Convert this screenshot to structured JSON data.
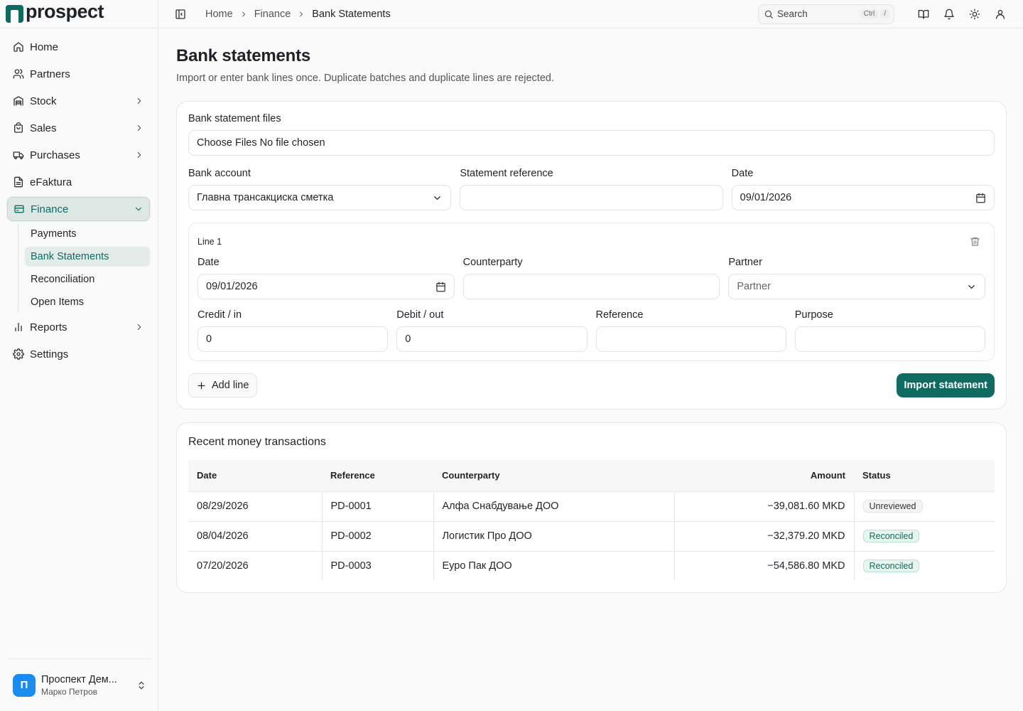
{
  "app": {
    "name": "prospect"
  },
  "sidebar": {
    "items": [
      {
        "label": "Home",
        "icon": "home-icon"
      },
      {
        "label": "Partners",
        "icon": "users-icon"
      },
      {
        "label": "Stock",
        "icon": "warehouse-icon"
      },
      {
        "label": "Sales",
        "icon": "shopping-bag-icon"
      },
      {
        "label": "Purchases",
        "icon": "truck-icon"
      },
      {
        "label": "eFaktura",
        "icon": "file-text-icon"
      },
      {
        "label": "Finance",
        "icon": "wallet-icon"
      },
      {
        "label": "Reports",
        "icon": "bar-chart-icon"
      },
      {
        "label": "Settings",
        "icon": "gear-icon"
      }
    ],
    "finance_sub": [
      {
        "label": "Payments"
      },
      {
        "label": "Bank Statements"
      },
      {
        "label": "Reconciliation"
      },
      {
        "label": "Open Items"
      }
    ],
    "user": {
      "initial": "П",
      "org": "Проспект Дем...",
      "name": "Марко Петров"
    }
  },
  "topbar": {
    "breadcrumb": [
      "Home",
      "Finance",
      "Bank Statements"
    ],
    "search": {
      "label": "Search",
      "kbd1": "Ctrl",
      "kbd2": "/"
    }
  },
  "page": {
    "title": "Bank statements",
    "subtitle": "Import or enter bank lines once. Duplicate batches and duplicate lines are rejected."
  },
  "form": {
    "files_label": "Bank statement files",
    "file_button": "Choose Files",
    "file_status": "No file chosen",
    "bank_account_label": "Bank account",
    "bank_account_value": "Главна трансакциска сметка",
    "statement_ref_label": "Statement reference",
    "statement_ref_value": "",
    "date_label": "Date",
    "date_value": "09/01/2026",
    "line": {
      "title": "Line 1",
      "date_label": "Date",
      "date_value": "09/01/2026",
      "counterparty_label": "Counterparty",
      "counterparty_value": "",
      "partner_label": "Partner",
      "partner_placeholder": "Partner",
      "credit_label": "Credit / in",
      "credit_value": "0",
      "debit_label": "Debit / out",
      "debit_value": "0",
      "reference_label": "Reference",
      "reference_value": "",
      "purpose_label": "Purpose",
      "purpose_value": ""
    },
    "add_line": "Add line",
    "import": "Import statement"
  },
  "transactions": {
    "title": "Recent money transactions",
    "columns": [
      "Date",
      "Reference",
      "Counterparty",
      "Amount",
      "Status"
    ],
    "rows": [
      {
        "date": "08/29/2026",
        "reference": "PD-0001",
        "counterparty": "Алфа Снабдување ДОО",
        "amount": "−39,081.60 MKD",
        "status": "Unreviewed"
      },
      {
        "date": "08/04/2026",
        "reference": "PD-0002",
        "counterparty": "Логистик Про ДОО",
        "amount": "−32,379.20 MKD",
        "status": "Reconciled"
      },
      {
        "date": "07/20/2026",
        "reference": "PD-0003",
        "counterparty": "Еуро Пак ДОО",
        "amount": "−54,586.80 MKD",
        "status": "Reconciled"
      }
    ]
  },
  "colors": {
    "accent": "#0f6b62",
    "avatar": "#1a8cf0",
    "reconciled_bg": "#e6f6ef"
  }
}
